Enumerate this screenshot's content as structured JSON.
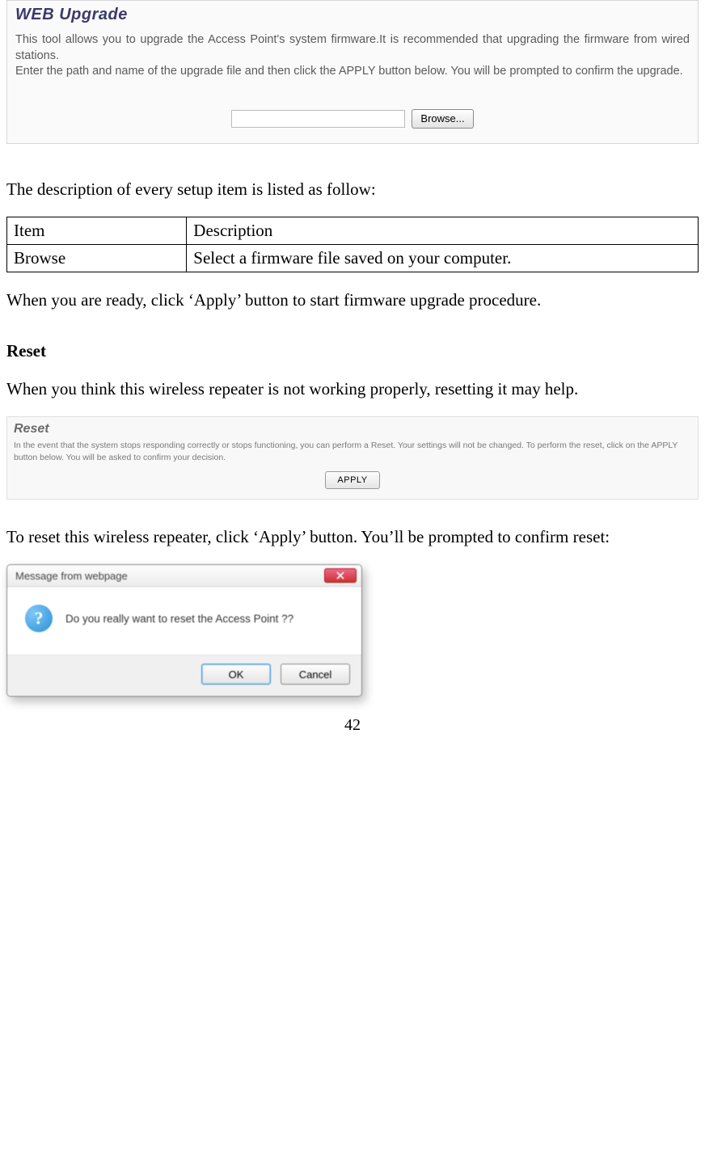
{
  "web_upgrade": {
    "title": "WEB Upgrade",
    "desc": "This tool allows you to upgrade the Access Point's system firmware.It is recommended that upgrading the firmware from wired stations.\nEnter the path and name of the upgrade file and then click the APPLY button below. You will be prompted to confirm the upgrade.",
    "file_value": "",
    "browse_label": "Browse..."
  },
  "intro_text": "The description of every setup item is listed as follow:",
  "table": {
    "headers": [
      "Item",
      "Description"
    ],
    "rows": [
      {
        "item": "Browse",
        "desc": "Select a firmware file saved on your computer."
      }
    ]
  },
  "apply_text": "When you are ready, click ‘Apply’ button to start firmware upgrade procedure.",
  "reset_heading": "Reset",
  "reset_intro": "When you think this wireless repeater is not working properly, resetting it may help.",
  "reset_panel": {
    "title": "Reset",
    "desc": "In the event that the system stops responding correctly or stops functioning, you can perform a Reset. Your settings will not be changed. To perform the reset, click on the APPLY button below. You will be asked to confirm your decision.",
    "apply_label": "APPLY"
  },
  "reset_confirm_text": "To reset this wireless repeater, click ‘Apply’ button. You’ll be prompted to confirm reset:",
  "dialog": {
    "title": "Message from webpage",
    "icon_glyph": "?",
    "message": "Do you really want to reset the Access Point ??",
    "ok_label": "OK",
    "cancel_label": "Cancel"
  },
  "page_number": "42"
}
